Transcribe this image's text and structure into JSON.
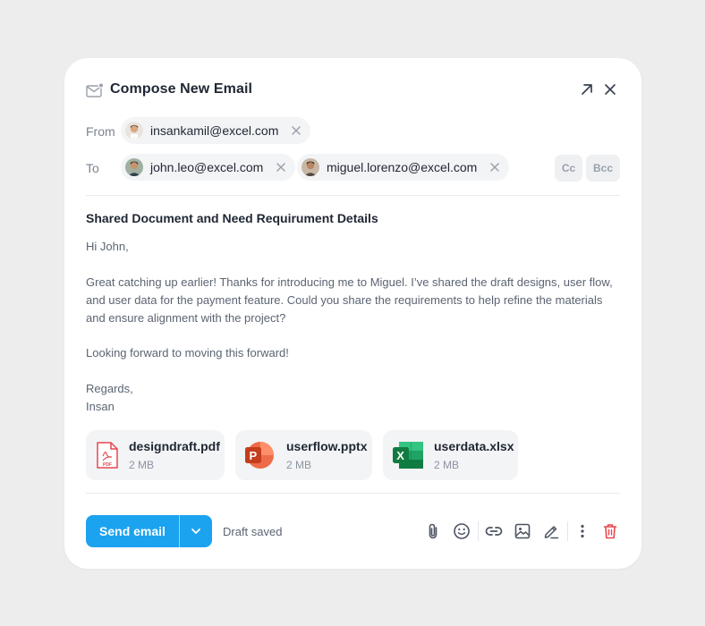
{
  "header": {
    "title": "Compose New Email"
  },
  "from": {
    "label": "From",
    "recipients": [
      {
        "email": "insankamil@excel.com"
      }
    ]
  },
  "to": {
    "label": "To",
    "recipients": [
      {
        "email": "john.leo@excel.com"
      },
      {
        "email": "miguel.lorenzo@excel.com"
      }
    ],
    "cc_label": "Cc",
    "bcc_label": "Bcc"
  },
  "email": {
    "subject": "Shared Document and Need Requirument Details",
    "greeting": "Hi John,",
    "paragraph1": "Great catching up earlier! Thanks for introducing me to Miguel. I’ve shared the draft designs, user flow, and user data for the payment feature. Could you share the requirements to help refine the materials and ensure alignment with the project?",
    "paragraph2": "Looking forward to moving this forward!",
    "signoff": "Regards,",
    "signature": "Insan"
  },
  "attachments": [
    {
      "name": "designdraft.pdf",
      "size": "2 MB",
      "type": "pdf-icon",
      "badge": "PDF"
    },
    {
      "name": "userflow.pptx",
      "size": "2 MB",
      "type": "powerpoint-icon",
      "badge": "P"
    },
    {
      "name": "userdata.xlsx",
      "size": "2 MB",
      "type": "excel-icon",
      "badge": "X"
    }
  ],
  "footer": {
    "send_label": "Send email",
    "draft_status": "Draft saved"
  },
  "colors": {
    "accent": "#1ba3ef",
    "delete": "#e5484d",
    "pdf": "#e5484d",
    "powerpoint": "#d24726",
    "excel": "#1e7145"
  }
}
